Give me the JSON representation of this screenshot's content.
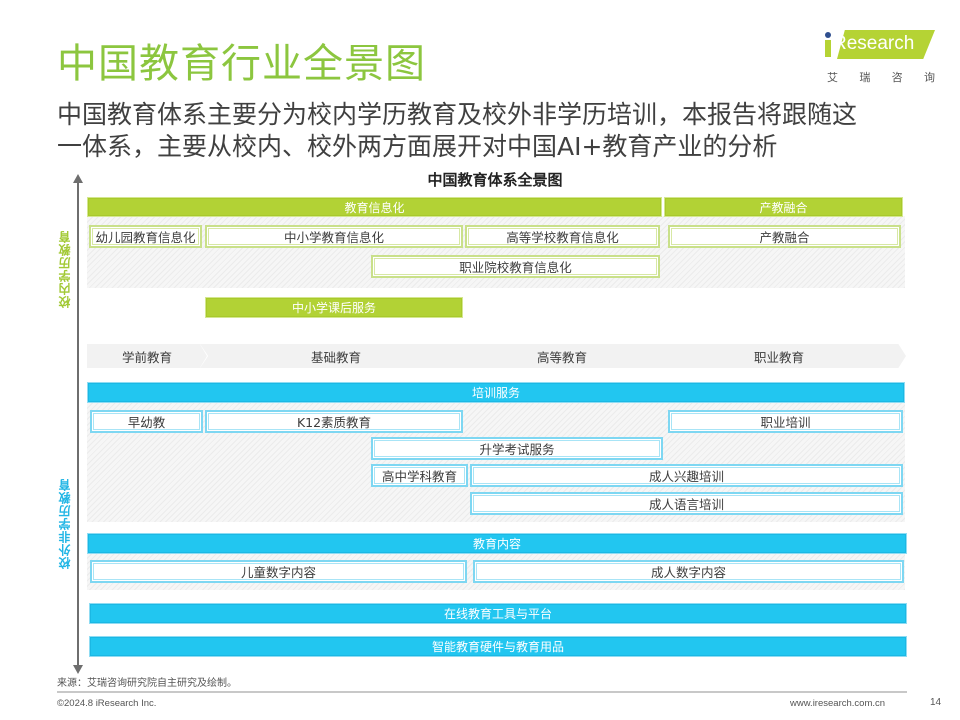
{
  "header": {
    "title": "中国教育行业全景图",
    "subtitle_line1": "中国教育体系主要分为校内学历教育及校外非学历培训，本报告将跟随这",
    "subtitle_line2": "一体系，主要从校内、校外两方面展开对中国AI+教育产业的分析"
  },
  "logo": {
    "brand": "Research",
    "brand_prefix": "i",
    "chinese_chars": [
      "艾",
      "瑞",
      "咨",
      "询"
    ],
    "accent_color": "#b5d334"
  },
  "diagram": {
    "title": "中国教育体系全景图",
    "axis_labels": {
      "in_school": "校内学历教育",
      "out_school": "校外非学历教育"
    },
    "colors": {
      "in_school": "#b2d235",
      "out_school": "#22c6f0",
      "stage_bg": "#f2f2f2"
    },
    "in_school": {
      "info_header": "教育信息化",
      "industry_header": "产教融合",
      "kindergarten_info": "幼儿园教育信息化",
      "k12_info": "中小学教育信息化",
      "higher_ed_info": "高等学校教育信息化",
      "industry_integration": "产教融合",
      "vocational_info": "职业院校教育信息化",
      "after_school": "中小学课后服务"
    },
    "stages": [
      "学前教育",
      "基础教育",
      "高等教育",
      "职业教育"
    ],
    "out_school": {
      "training_header": "培训服务",
      "early_childhood": "早幼教",
      "k12_quality": "K12素质教育",
      "vocational_training": "职业培训",
      "exam_services": "升学考试服务",
      "high_school_subject": "高中学科教育",
      "adult_interest": "成人兴趣培训",
      "adult_language": "成人语言培训",
      "content_header": "教育内容",
      "children_digital": "儿童数字内容",
      "adult_digital": "成人数字内容",
      "online_tools": "在线教育工具与平台",
      "smart_hardware": "智能教育硬件与教育用品"
    }
  },
  "footer": {
    "source": "来源：艾瑞咨询研究院自主研究及绘制。",
    "copyright": "©2024.8 iResearch Inc.",
    "website": "www.iresearch.com.cn",
    "page_number": "14"
  }
}
